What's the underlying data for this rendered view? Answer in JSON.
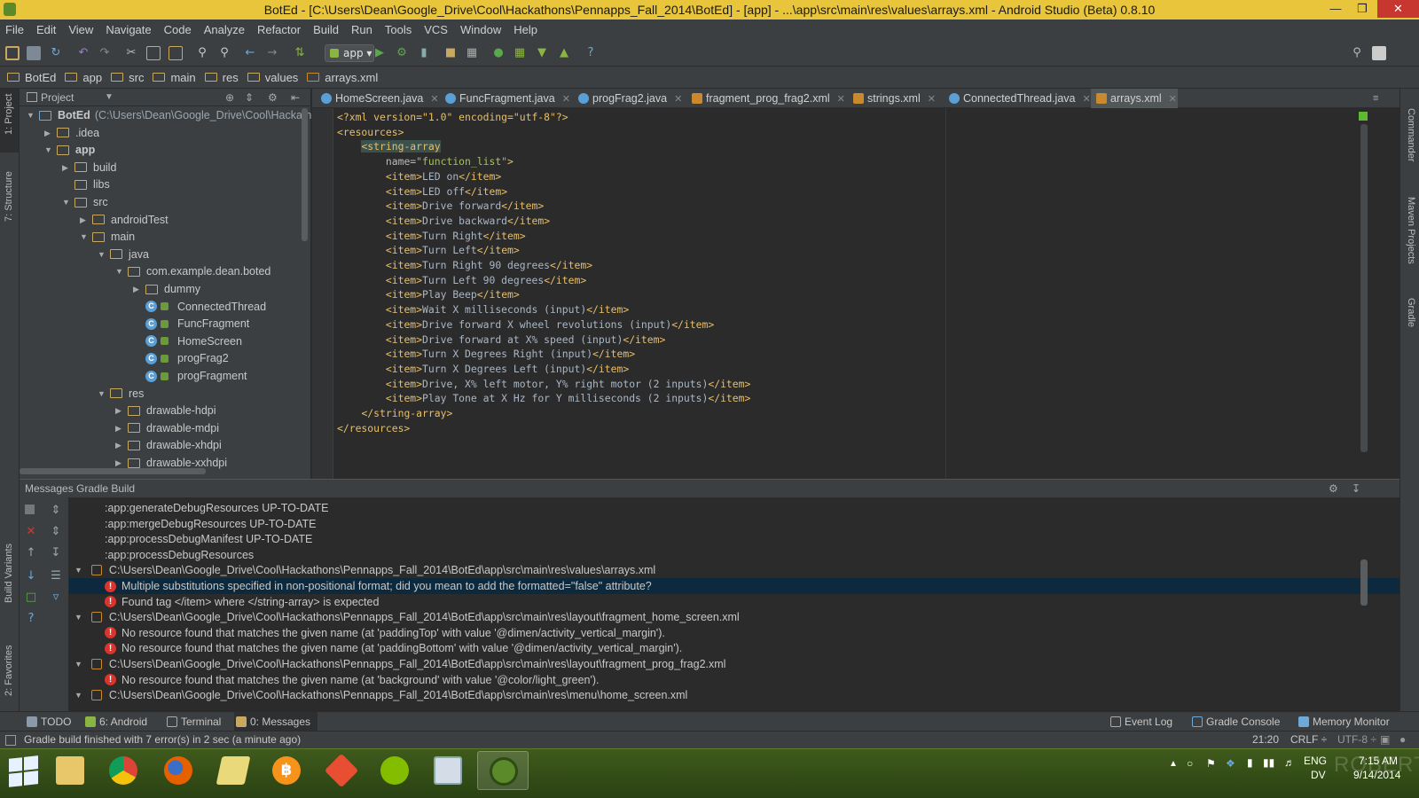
{
  "window": {
    "title": "BotEd - [C:\\Users\\Dean\\Google_Drive\\Cool\\Hackathons\\Pennapps_Fall_2014\\BotEd] - [app] - ...\\app\\src\\main\\res\\values\\arrays.xml - Android Studio (Beta) 0.8.10"
  },
  "menu": [
    "File",
    "Edit",
    "View",
    "Navigate",
    "Code",
    "Analyze",
    "Refactor",
    "Build",
    "Run",
    "Tools",
    "VCS",
    "Window",
    "Help"
  ],
  "toolbar": {
    "run_config": "app",
    "help": "?"
  },
  "breadcrumbs": [
    "BotEd",
    "app",
    "src",
    "main",
    "res",
    "values",
    "arrays.xml"
  ],
  "left_strip": {
    "project": "1: Project",
    "structure": "7: Structure",
    "build_variants": "Build Variants",
    "favorites": "2: Favorites"
  },
  "right_strip": {
    "commander": "Commander",
    "maven": "Maven Projects",
    "gradle": "Gradle"
  },
  "project": {
    "header": "Project",
    "root_name": "BotEd",
    "root_path": "(C:\\Users\\Dean\\Google_Drive\\Cool\\Hackathon",
    "tree": [
      {
        "label": "BotEd",
        "depth": 0,
        "kind": "module"
      },
      {
        "label": ".idea",
        "depth": 1,
        "kind": "folder"
      },
      {
        "label": "app",
        "depth": 1,
        "kind": "folder"
      },
      {
        "label": "build",
        "depth": 2,
        "kind": "folder"
      },
      {
        "label": "libs",
        "depth": 2,
        "kind": "folder"
      },
      {
        "label": "src",
        "depth": 2,
        "kind": "folder"
      },
      {
        "label": "androidTest",
        "depth": 3,
        "kind": "folder"
      },
      {
        "label": "main",
        "depth": 3,
        "kind": "folder"
      },
      {
        "label": "java",
        "depth": 4,
        "kind": "folder"
      },
      {
        "label": "com.example.dean.boted",
        "depth": 5,
        "kind": "folder"
      },
      {
        "label": "dummy",
        "depth": 6,
        "kind": "folder"
      },
      {
        "label": "ConnectedThread",
        "depth": 6,
        "kind": "class"
      },
      {
        "label": "FuncFragment",
        "depth": 6,
        "kind": "class"
      },
      {
        "label": "HomeScreen",
        "depth": 6,
        "kind": "class"
      },
      {
        "label": "progFrag2",
        "depth": 6,
        "kind": "class"
      },
      {
        "label": "progFragment",
        "depth": 6,
        "kind": "class"
      },
      {
        "label": "res",
        "depth": 4,
        "kind": "folder"
      },
      {
        "label": "drawable-hdpi",
        "depth": 5,
        "kind": "folder"
      },
      {
        "label": "drawable-mdpi",
        "depth": 5,
        "kind": "folder"
      },
      {
        "label": "drawable-xhdpi",
        "depth": 5,
        "kind": "folder"
      },
      {
        "label": "drawable-xxhdpi",
        "depth": 5,
        "kind": "folder"
      }
    ]
  },
  "tabs": [
    "HomeScreen.java",
    "FuncFragment.java",
    "progFrag2.java",
    "fragment_prog_frag2.xml",
    "strings.xml",
    "ConnectedThread.java",
    "arrays.xml"
  ],
  "editor": {
    "xml_decl": "<?xml version=\"1.0\" encoding=\"utf-8\"?>",
    "resources_open": "<resources>",
    "string_array_open": "<string-array",
    "name_attr": "name=",
    "name_value": "\"function_list\"",
    "name_close": ">",
    "items": [
      "LED on",
      "LED off",
      "Drive forward",
      "Drive backward",
      "Turn Right",
      "Turn Left",
      "Turn Right 90 degrees",
      "Turn Left 90 degrees",
      "Play Beep",
      "Wait X milliseconds (input)",
      "Drive forward X wheel revolutions (input)",
      "Drive forward at X% speed (input)",
      "Turn X Degrees Right (input)",
      "Turn X Degrees Left (input)",
      "Drive, X% left motor, Y% right motor (2 inputs)",
      "Play Tone at X Hz for Y milliseconds (2 inputs)"
    ],
    "item_open": "<item>",
    "item_close": "</item>",
    "string_array_close": "</string-array>",
    "resources_close": "</resources>"
  },
  "messages": {
    "header": "Messages Gradle Build",
    "rows": [
      {
        "kind": "plain",
        "text": ":app:generateDebugResources UP-TO-DATE"
      },
      {
        "kind": "plain",
        "text": ":app:mergeDebugResources UP-TO-DATE"
      },
      {
        "kind": "plain",
        "text": ":app:processDebugManifest UP-TO-DATE"
      },
      {
        "kind": "plain",
        "text": ":app:processDebugResources"
      },
      {
        "kind": "file",
        "text": "C:\\Users\\Dean\\Google_Drive\\Cool\\Hackathons\\Pennapps_Fall_2014\\BotEd\\app\\src\\main\\res\\values\\arrays.xml"
      },
      {
        "kind": "error",
        "text": "Multiple substitutions specified in non-positional format; did you mean to add the formatted=\"false\" attribute?",
        "selected": true
      },
      {
        "kind": "error",
        "text": "Found tag </item> where </string-array> is expected"
      },
      {
        "kind": "file",
        "text": "C:\\Users\\Dean\\Google_Drive\\Cool\\Hackathons\\Pennapps_Fall_2014\\BotEd\\app\\src\\main\\res\\layout\\fragment_home_screen.xml"
      },
      {
        "kind": "error",
        "text": "No resource found that matches the given name (at 'paddingTop' with value '@dimen/activity_vertical_margin')."
      },
      {
        "kind": "error",
        "text": "No resource found that matches the given name (at 'paddingBottom' with value '@dimen/activity_vertical_margin')."
      },
      {
        "kind": "file",
        "text": "C:\\Users\\Dean\\Google_Drive\\Cool\\Hackathons\\Pennapps_Fall_2014\\BotEd\\app\\src\\main\\res\\layout\\fragment_prog_frag2.xml"
      },
      {
        "kind": "error",
        "text": "No resource found that matches the given name (at 'background' with value '@color/light_green')."
      },
      {
        "kind": "file",
        "text": "C:\\Users\\Dean\\Google_Drive\\Cool\\Hackathons\\Pennapps_Fall_2014\\BotEd\\app\\src\\main\\res\\menu\\home_screen.xml"
      }
    ]
  },
  "bottom_tools": {
    "todo": "TODO",
    "android": "6: Android",
    "terminal": "Terminal",
    "messages": "0: Messages",
    "event_log": "Event Log",
    "gradle_console": "Gradle Console",
    "memory_monitor": "Memory Monitor"
  },
  "status": {
    "message": "Gradle build finished with 7 error(s) in 2 sec (a minute ago)",
    "position": "21:20",
    "line_sep": "CRLF ÷",
    "encoding": "UTF-8 ÷"
  },
  "taskbar": {
    "apps": [
      "file-explorer",
      "chrome",
      "firefox",
      "file-manager",
      "bitcoin",
      "git",
      "spotify",
      "calculator",
      "android-studio"
    ],
    "lang": "ENG",
    "lang_sub": "DV",
    "time": "7:15 AM",
    "date": "9/14/2014",
    "watermark": "ROBERTOTUNE"
  },
  "colors": {
    "title_bar": "#e8c53a",
    "editor_bg": "#2b2b2b",
    "panel_bg": "#3c3f41",
    "xml_tag": "#e8bf6a",
    "xml_string": "#a5c25c",
    "error": "#d9352c",
    "selection": "#0d293e",
    "taskbar": "#3f5a1c"
  }
}
